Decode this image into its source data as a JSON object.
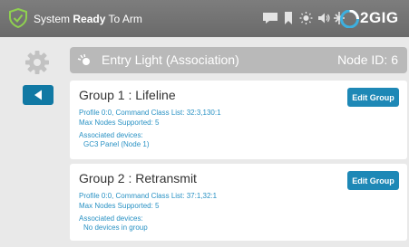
{
  "topbar": {
    "status_prefix": "System",
    "status_bold": "Ready",
    "status_suffix": "To Arm",
    "brand": "2GIG",
    "icons": [
      "shield-check-icon",
      "message-icon",
      "bookmark-icon",
      "brightness-icon",
      "volume-icon",
      "alert-icon",
      "2gig-logo-icon"
    ]
  },
  "header": {
    "title": "Entry Light (Association)",
    "node_id": "Node ID: 6"
  },
  "groups": [
    {
      "title": "Group 1 : Lifeline",
      "profile": "Profile 0:0, Command Class List: 32:3,130:1",
      "max_nodes": "Max Nodes Supported: 5",
      "associated_label": "Associated devices:",
      "associated_value": "GC3 Panel (Node 1)",
      "edit_label": "Edit Group"
    },
    {
      "title": "Group 2 : Retransmit",
      "profile": "Profile 0:0, Command Class List: 37:1,32:1",
      "max_nodes": "Max Nodes Supported: 5",
      "associated_label": "Associated devices:",
      "associated_value": "No devices in group",
      "edit_label": "Edit Group"
    }
  ],
  "colors": {
    "accent": "#1179a4",
    "link_text": "#2a92c4",
    "topbar": "#727272",
    "header": "#b9b9b9"
  }
}
